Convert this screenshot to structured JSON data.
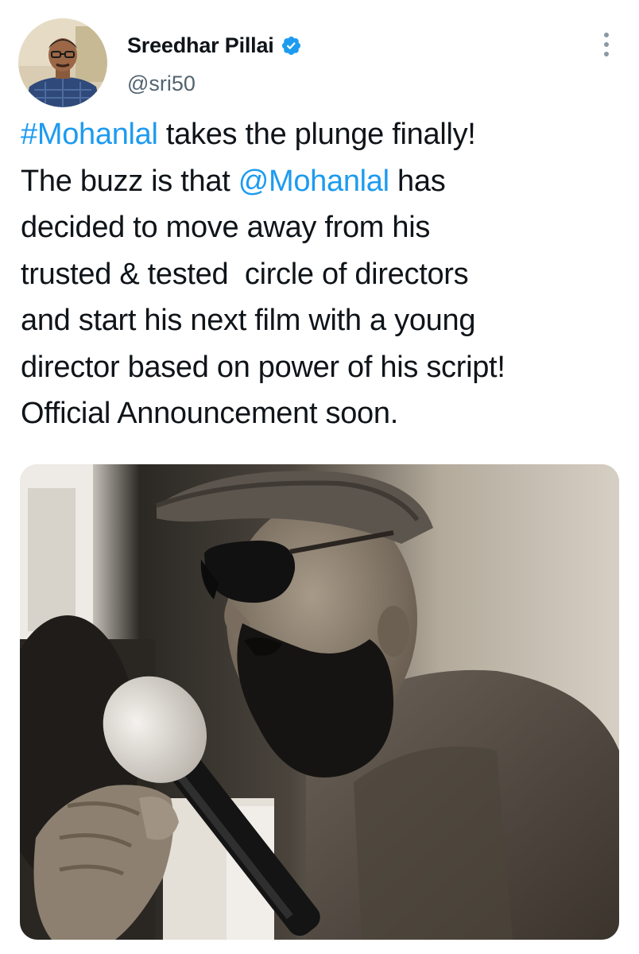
{
  "author": {
    "display_name": "Sreedhar Pillai",
    "handle": "@sri50",
    "verified": true,
    "avatar_icon": "profile-photo"
  },
  "menu": {
    "icon": "more-vertical-icon"
  },
  "tweet": {
    "lines": [
      [
        {
          "text": "#Mohanlal",
          "link": true
        },
        {
          "text": " takes the plunge finally!",
          "link": false
        }
      ],
      [
        {
          "text": "The buzz is that ",
          "link": false
        },
        {
          "text": "@Mohanlal",
          "link": true
        },
        {
          "text": " has",
          "link": false
        }
      ],
      [
        {
          "text": "decided to move away from his",
          "link": false
        }
      ],
      [
        {
          "text": "trusted & tested  circle of directors",
          "link": false
        }
      ],
      [
        {
          "text": "and start his next film with a young",
          "link": false
        }
      ],
      [
        {
          "text": "director based on power of his script!",
          "link": false
        }
      ],
      [
        {
          "text": "Official Announcement soon.",
          "link": false
        }
      ]
    ]
  },
  "media": {
    "type": "photo",
    "tone": "sepia-monochrome"
  },
  "colors": {
    "link": "#1d9bf0",
    "verified": "#1d9bf0",
    "text": "#0f1419",
    "secondary": "#536471"
  }
}
